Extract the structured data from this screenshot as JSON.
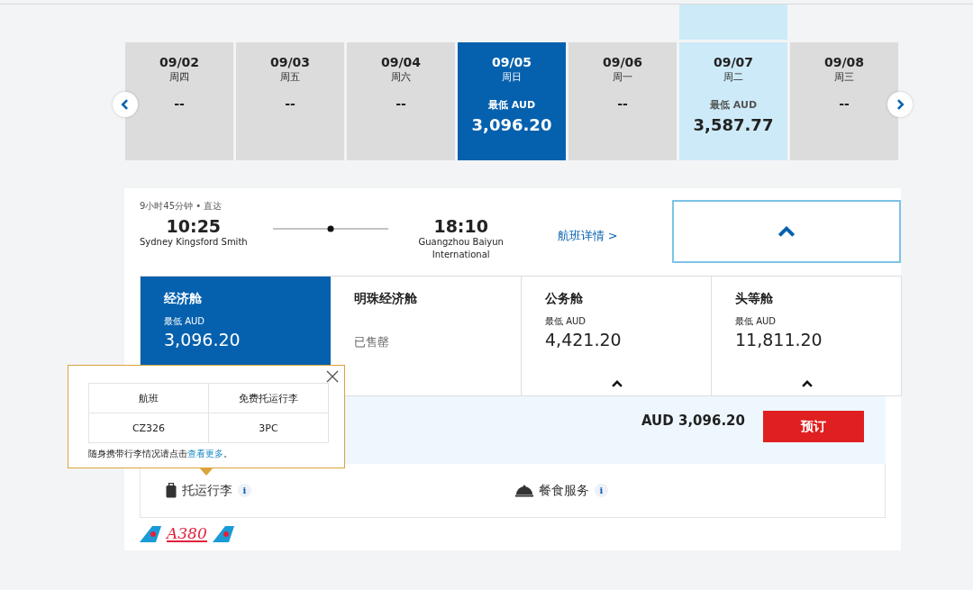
{
  "dates": [
    {
      "date": "09/02",
      "weekday": "周四",
      "price": "--",
      "selected": false,
      "highlighted": false
    },
    {
      "date": "09/03",
      "weekday": "周五",
      "price": "--",
      "selected": false,
      "highlighted": false
    },
    {
      "date": "09/04",
      "weekday": "周六",
      "price": "--",
      "selected": false,
      "highlighted": false
    },
    {
      "date": "09/05",
      "weekday": "周日",
      "price_label": "最低 AUD",
      "price": "3,096.20",
      "selected": true,
      "highlighted": false
    },
    {
      "date": "09/06",
      "weekday": "周一",
      "price": "--",
      "selected": false,
      "highlighted": false
    },
    {
      "date": "09/07",
      "weekday": "周二",
      "price_label": "最低 AUD",
      "price": "3,587.77",
      "selected": false,
      "highlighted": true
    },
    {
      "date": "09/08",
      "weekday": "周三",
      "price": "--",
      "selected": false,
      "highlighted": false
    }
  ],
  "flight": {
    "duration": "9小时45分钟 • 直达",
    "depart_time": "10:25",
    "depart_airport": "Sydney Kingsford Smith",
    "arrive_time": "18:10",
    "arrive_airport": "Guangzhou Baiyun International",
    "details_link": "航班详情 >",
    "expanded": true
  },
  "cabins": [
    {
      "kind": "fare",
      "name": "经济舱",
      "price_label": "最低 AUD",
      "price": "3,096.20",
      "selected": true,
      "toggle": false
    },
    {
      "kind": "soldout",
      "name": "明珠经济舱",
      "status": "已售罄",
      "selected": false,
      "toggle": false
    },
    {
      "kind": "fare",
      "name": "公务舱",
      "price_label": "最低 AUD",
      "price": "4,421.20",
      "selected": false,
      "toggle": true
    },
    {
      "kind": "fare",
      "name": "头等舱",
      "price_label": "最低 AUD",
      "price": "11,811.20",
      "selected": false,
      "toggle": true
    }
  ],
  "booking": {
    "total": "AUD 3,096.20",
    "button": "预订"
  },
  "services": [
    {
      "kind": "baggage",
      "label": "托运行李",
      "info": "i"
    },
    {
      "kind": "meal",
      "label": "餐食服务",
      "info": "i"
    }
  ],
  "logo": {
    "aircraft": "A380"
  },
  "popup": {
    "columns": [
      "航班",
      "免费托运行李"
    ],
    "rows": [
      [
        "CZ326",
        "3PC"
      ]
    ],
    "note": "随身携带行李情况请点击",
    "link": "查看更多",
    "note_end": "。"
  }
}
